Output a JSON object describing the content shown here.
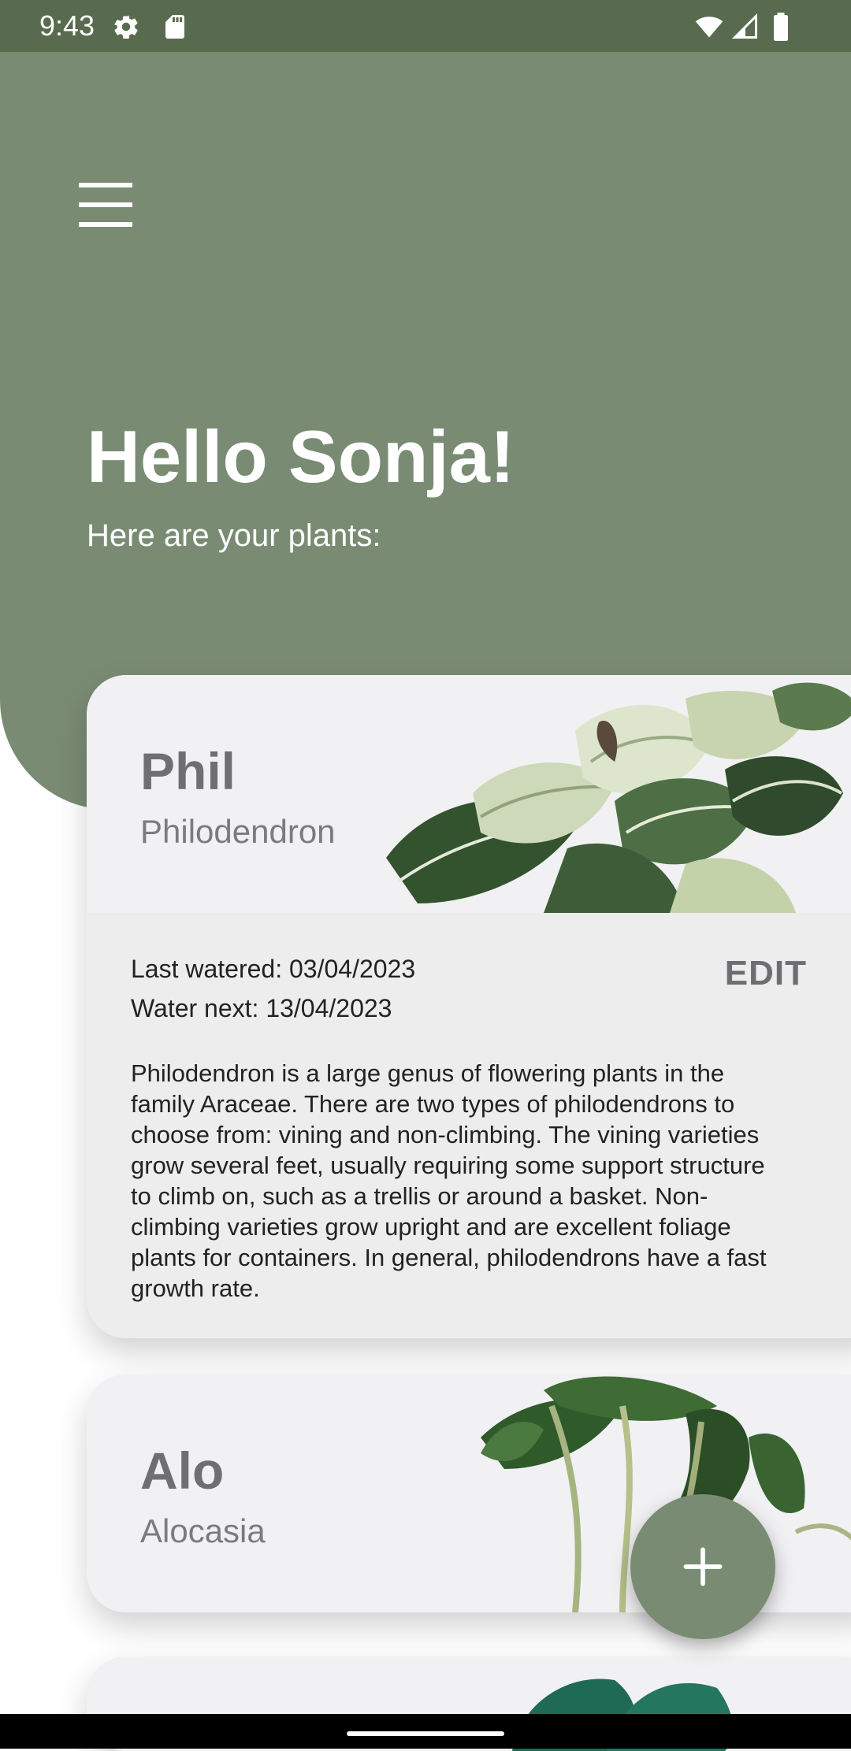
{
  "status_bar": {
    "time": "9:43",
    "icons": [
      "settings-icon",
      "sd-card-icon",
      "wifi-icon",
      "signal-icon",
      "battery-icon"
    ],
    "color": "#586B4E"
  },
  "header": {
    "greeting": "Hello Sonja!",
    "subtitle": "Here are your plants:",
    "menu_icon": "hamburger-menu-icon",
    "color": "#7A8B74"
  },
  "plants": [
    {
      "name": "Phil",
      "species": "Philodendron",
      "expanded": true,
      "last_watered": "Last watered: 03/04/2023",
      "water_next": "Water next: 13/04/2023",
      "edit_label": "EDIT",
      "description": "Philodendron is a large genus of flowering plants in the family Araceae. There are two types of philodendrons to choose from: vining and non-climbing. The vining varieties grow several feet, usually requiring some support structure to climb on, such as a trellis or around a basket. Non-climbing varieties grow upright and are excellent foliage plants for containers. In general, philodendrons have a fast growth rate."
    },
    {
      "name": "Alo",
      "species": "Alocasia",
      "expanded": false
    },
    {
      "name": "",
      "species": "",
      "expanded": false
    }
  ],
  "fab": {
    "icon": "plus-icon"
  }
}
